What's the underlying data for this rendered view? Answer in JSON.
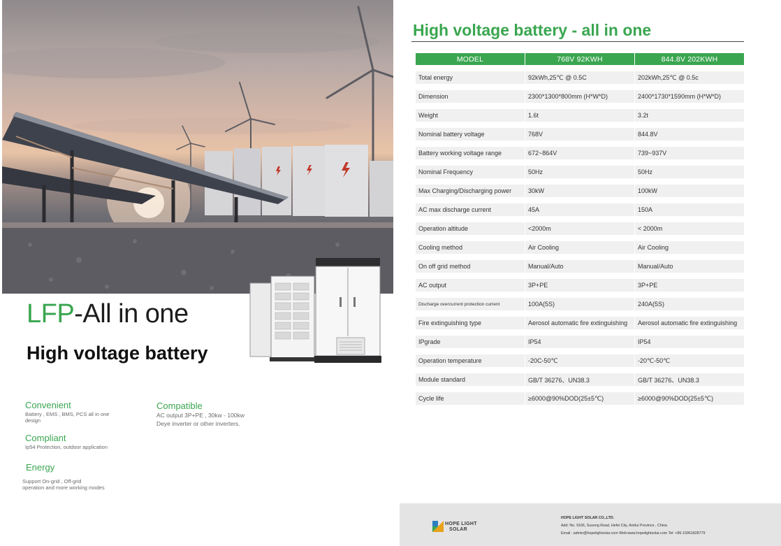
{
  "left": {
    "title_accent": "LFP",
    "title_rest": "-All in one",
    "subtitle": "High voltage  battery",
    "features": {
      "convenient": {
        "title": "Convenient",
        "desc": "Battery , EMS , BMS, PCS all in one design"
      },
      "compatible": {
        "title": "Compatible",
        "desc_line1": "AC output 3P+PE , 30kw - 100kw",
        "desc_line2": "Deye inverter or other inverters."
      },
      "compliant": {
        "title": "Compliant",
        "desc": "Ip54 Protection, outdoor application"
      },
      "energy": {
        "title": "Energy",
        "desc_line1": "Support On-grid , Off-grid",
        "desc_line2": "operation and more working modes"
      }
    }
  },
  "right": {
    "heading": "High voltage  battery - all in one",
    "table": {
      "headers": [
        "MODEL",
        "768V 92KWH",
        "844.8V 202KWH"
      ],
      "rows": [
        [
          "Total energy",
          "92kWh,25℃ @ 0.5C",
          "202kWh,25℃ @ 0.5c"
        ],
        [
          "Dimension",
          "2300*1300*800mm (H*W*D)",
          "2400*1730*1590mm (H*W*D)"
        ],
        [
          "Weight",
          "1.6t",
          "3.2t"
        ],
        [
          "Nominal battery voltage",
          "768V",
          "844.8V"
        ],
        [
          "Battery working voltage range",
          "672~864V",
          "739~937V"
        ],
        [
          "Nominal Frequency",
          "50Hz",
          "50Hz"
        ],
        [
          "Max Charging/Discharging power",
          "30kW",
          "100kW"
        ],
        [
          "AC max discharge current",
          "45A",
          "150A"
        ],
        [
          "Operation altitude",
          "<2000m",
          "< 2000m"
        ],
        [
          "Cooling method",
          "Air Cooling",
          "Air Cooling"
        ],
        [
          "On off grid method",
          "Manual/Auto",
          "Manual/Auto"
        ],
        [
          "AC output",
          "3P+PE",
          "3P+PE"
        ],
        [
          "Discharge overcurrent protection current",
          "100A(5S)",
          "240A(5S)"
        ],
        [
          "Fire extinguishing type",
          "Aerosol automatic fire extinguishing",
          "Aerosol automatic fire extinguishing"
        ],
        [
          "IPgrade",
          "IP54",
          "IP54"
        ],
        [
          "Operation temperature",
          "-20C-50℃",
          "-20℃-50℃"
        ],
        [
          "Module standard",
          "GB/T 36276、UN38.3",
          "GB/T 36276、UN38.3"
        ],
        [
          "Cycle life",
          "≥6000@90%DOD(25±5℃)",
          "≥6000@90%DOD(25±5℃)"
        ]
      ]
    },
    "footer": {
      "logo_line1": "HOPE LIGHT",
      "logo_line2": "SOLAR",
      "company_name": "HOPE LIGHT SOLAR CO.,LTD.",
      "address": "Add: No. 9166, Susong Road, Hefei City, AnHui Province , China",
      "contact": "Email : admin@hopelightsolar.com   Web:www.hopelightsolar.com  Tel: +86-15961828779"
    }
  }
}
